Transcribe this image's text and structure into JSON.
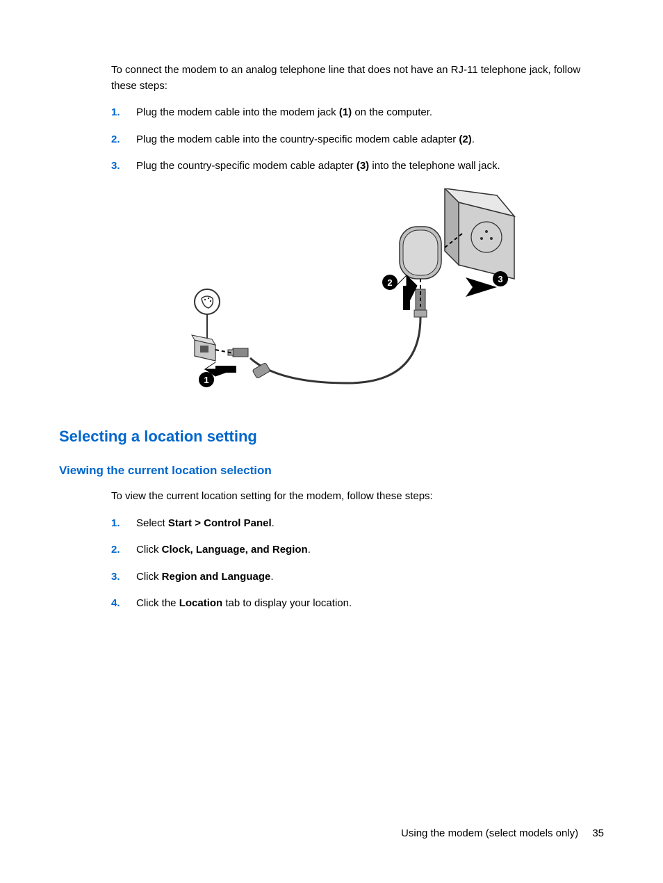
{
  "intro": "To connect the modem to an analog telephone line that does not have an RJ-11 telephone jack, follow these steps:",
  "steps1": [
    {
      "num": "1.",
      "parts": [
        {
          "text": "Plug the modem cable into the modem jack ",
          "bold": false
        },
        {
          "text": "(1)",
          "bold": true
        },
        {
          "text": " on the computer.",
          "bold": false
        }
      ]
    },
    {
      "num": "2.",
      "parts": [
        {
          "text": "Plug the modem cable into the country-specific modem cable adapter ",
          "bold": false
        },
        {
          "text": "(2)",
          "bold": true
        },
        {
          "text": ".",
          "bold": false
        }
      ]
    },
    {
      "num": "3.",
      "parts": [
        {
          "text": "Plug the country-specific modem cable adapter ",
          "bold": false
        },
        {
          "text": "(3)",
          "bold": true
        },
        {
          "text": " into the telephone wall jack.",
          "bold": false
        }
      ]
    }
  ],
  "heading2": "Selecting a location setting",
  "heading3": "Viewing the current location selection",
  "section_intro": "To view the current location setting for the modem, follow these steps:",
  "steps2": [
    {
      "num": "1.",
      "parts": [
        {
          "text": "Select ",
          "bold": false
        },
        {
          "text": "Start > Control Panel",
          "bold": true
        },
        {
          "text": ".",
          "bold": false
        }
      ]
    },
    {
      "num": "2.",
      "parts": [
        {
          "text": "Click ",
          "bold": false
        },
        {
          "text": "Clock, Language, and Region",
          "bold": true
        },
        {
          "text": ".",
          "bold": false
        }
      ]
    },
    {
      "num": "3.",
      "parts": [
        {
          "text": "Click ",
          "bold": false
        },
        {
          "text": "Region and Language",
          "bold": true
        },
        {
          "text": ".",
          "bold": false
        }
      ]
    },
    {
      "num": "4.",
      "parts": [
        {
          "text": "Click the ",
          "bold": false
        },
        {
          "text": "Location",
          "bold": true
        },
        {
          "text": " tab to display your location.",
          "bold": false
        }
      ]
    }
  ],
  "footer_text": "Using the modem (select models only)",
  "page_number": "35"
}
